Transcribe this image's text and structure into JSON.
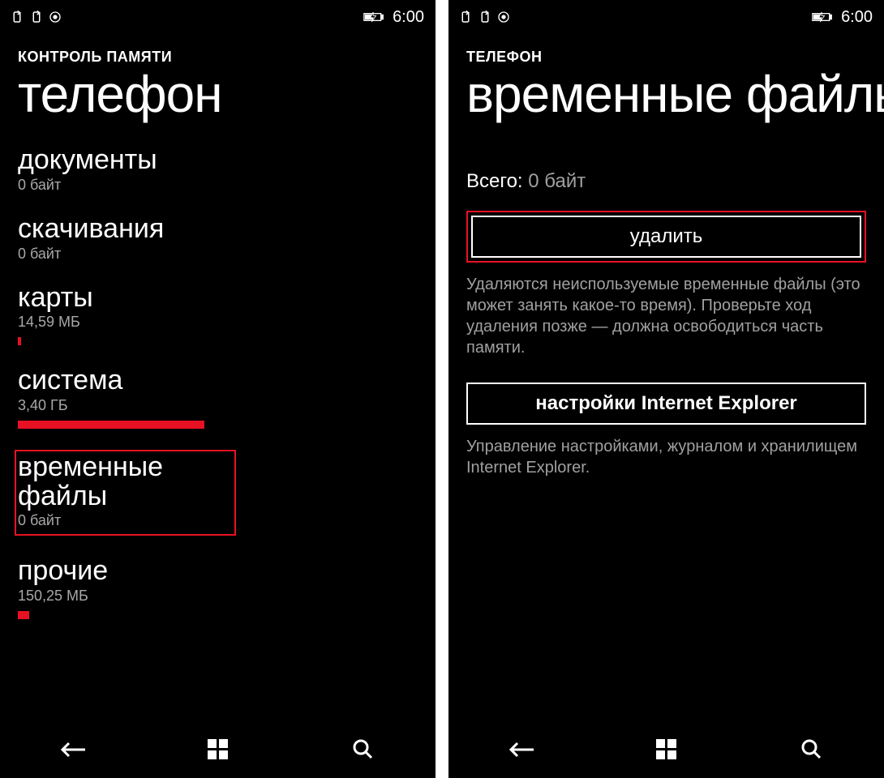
{
  "status": {
    "time": "6:00"
  },
  "left": {
    "app_label": "КОНТРОЛЬ ПАМЯТИ",
    "title": "телефон",
    "categories": [
      {
        "name": "документы",
        "size": "0 байт",
        "bar": null
      },
      {
        "name": "скачивания",
        "size": "0 байт",
        "bar": null
      },
      {
        "name": "карты",
        "size": "14,59 МБ",
        "bar": "tiny"
      },
      {
        "name": "система",
        "size": "3,40 ГБ",
        "bar": "med"
      },
      {
        "name": "временные файлы",
        "size": "0 байт",
        "bar": null,
        "highlight": true
      },
      {
        "name": "прочие",
        "size": "150,25 МБ",
        "bar": "sm"
      }
    ]
  },
  "right": {
    "app_label": "ТЕЛЕФОН",
    "title": "временные файлы",
    "total_label": "Всего:",
    "total_value": "0 байт",
    "delete_button": "удалить",
    "delete_desc": "Удаляются неиспользуемые временные файлы (это может занять какое-то время). Проверьте ход удаления позже — должна освободиться часть памяти.",
    "ie_button": "настройки Internet Explorer",
    "ie_desc": "Управление настройками, журналом и хранилищем Internet Explorer."
  },
  "icons": {
    "vibrate": "vibrate-icon",
    "location": "location-icon",
    "battery": "battery-icon"
  }
}
